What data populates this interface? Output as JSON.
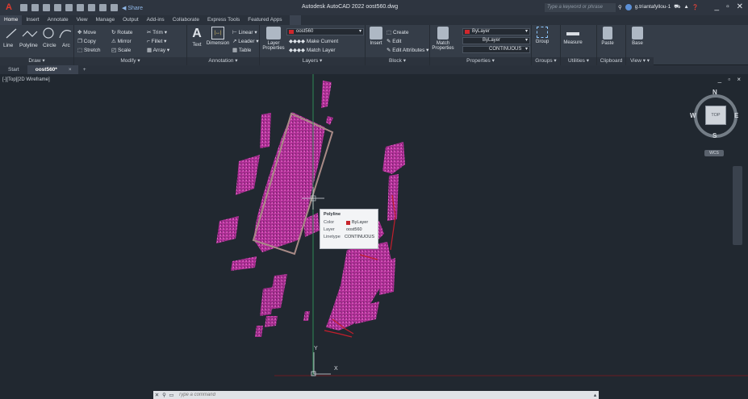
{
  "title_bar": {
    "logo": "A",
    "share_label": "Share",
    "window_title": "Autodesk AutoCAD 2022   oost560.dwg",
    "search_placeholder": "Type a keyword or phrase",
    "user_name": "g.triantafyllou-1",
    "icons": [
      "app-menu-icon",
      "new-icon",
      "open-icon",
      "save-icon",
      "saveas-icon",
      "web-icon",
      "mobile-icon",
      "plot-icon",
      "undo-icon",
      "redo-icon",
      "share-icon",
      "search-icon",
      "user-icon",
      "cart-icon",
      "a360-icon",
      "help-icon",
      "minimize-icon",
      "maximize-icon",
      "close-icon"
    ]
  },
  "ribbon_tabs": [
    "Home",
    "Insert",
    "Annotate",
    "View",
    "Manage",
    "Output",
    "Add-ins",
    "Collaborate",
    "Express Tools",
    "Featured Apps"
  ],
  "ribbon": {
    "draw": {
      "title": "Draw",
      "line": "Line",
      "polyline": "Polyline",
      "circle": "Circle",
      "arc": "Arc"
    },
    "modify": {
      "title": "Modify",
      "move": "Move",
      "rotate": "Rotate",
      "trim": "Trim",
      "copy": "Copy",
      "mirror": "Mirror",
      "fillet": "Fillet",
      "stretch": "Stretch",
      "scale": "Scale",
      "array": "Array"
    },
    "annotation": {
      "title": "Annotation",
      "text": "Text",
      "dimension": "Dimension",
      "linear": "Linear",
      "leader": "Leader",
      "table": "Table"
    },
    "layers": {
      "title": "Layers",
      "layer_properties_1": "Layer",
      "layer_properties_2": "Properties",
      "current_layer": "oost560",
      "make_current": "Make Current",
      "match_layer": "Match Layer"
    },
    "block": {
      "title": "Block",
      "insert": "Insert",
      "create": "Create",
      "edit": "Edit",
      "edit_attributes": "Edit Attributes"
    },
    "properties": {
      "title": "Properties",
      "match_1": "Match",
      "match_2": "Properties",
      "color": "ByLayer",
      "lineweight": "ByLayer",
      "linetype": "CONTINUOUS"
    },
    "groups": {
      "title": "Groups",
      "group": "Group"
    },
    "utilities": {
      "title": "Utilities",
      "measure": "Measure"
    },
    "clipboard": {
      "title": "Clipboard",
      "paste": "Paste"
    },
    "view": {
      "title": "View",
      "base": "Base"
    }
  },
  "doc_tabs": {
    "start": "Start",
    "active": "oost560*",
    "close": "×",
    "new": "+"
  },
  "viewport": {
    "label": "[-][Top][2D Wireframe]",
    "controls": "_ ▫ ×",
    "axis_x": "X",
    "axis_y": "Y",
    "viewcube": {
      "n": "N",
      "s": "S",
      "e": "E",
      "w": "W",
      "top": "TOP",
      "wcs": "WCS"
    }
  },
  "tooltip": {
    "title": "Polyline",
    "rows": [
      {
        "key": "Color",
        "value": "ByLayer"
      },
      {
        "key": "Layer",
        "value": "oost560"
      },
      {
        "key": "Linetype",
        "value": "CONTINUOUS"
      }
    ]
  },
  "command_line": {
    "placeholder": "Type a command"
  },
  "colors": {
    "point_cloud": "#c93aa8",
    "polyline": "#a88a86",
    "accent_red": "#c21e2c",
    "ucs_green": "#2f8a55"
  }
}
